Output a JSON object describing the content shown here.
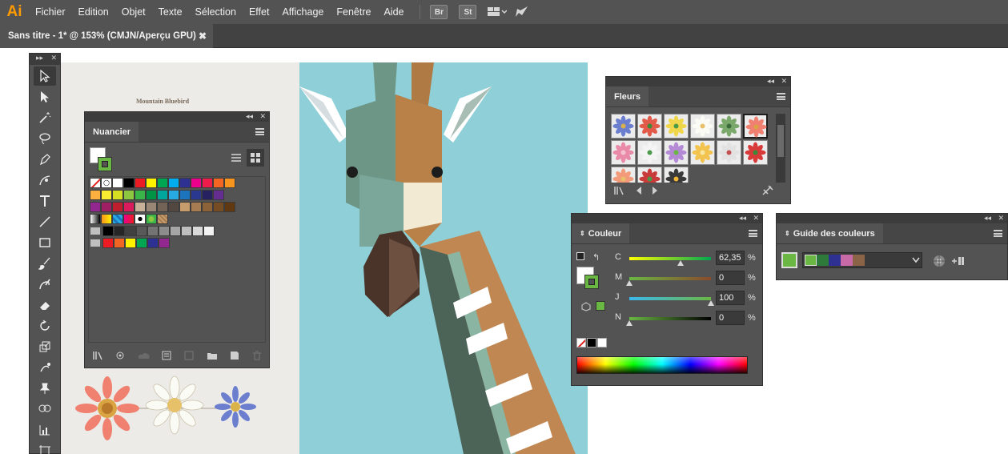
{
  "app": {
    "logo": "Ai"
  },
  "menu": [
    "Fichier",
    "Edition",
    "Objet",
    "Texte",
    "Sélection",
    "Effet",
    "Affichage",
    "Fenêtre",
    "Aide"
  ],
  "menubar_icons": {
    "bridge": "Br",
    "stock": "St",
    "workspace": "workspace-layout-icon",
    "send": "rocket-icon"
  },
  "document": {
    "tab_title": "Sans titre - 1* @ 153% (CMJN/Aperçu GPU)",
    "close": "✖"
  },
  "artboard": {
    "caption": "Mountain Bluebird"
  },
  "toolbar": {
    "tools": [
      "selection-tool",
      "direct-selection-tool",
      "magic-wand-tool",
      "lasso-tool",
      "pen-tool",
      "curvature-tool",
      "type-tool",
      "line-tool",
      "rectangle-tool",
      "paintbrush-tool",
      "shaper-tool",
      "eraser-tool",
      "rotate-tool",
      "scale-tool",
      "puppet-warp-tool",
      "pin-tool",
      "blend-tool",
      "graph-tool",
      "artboard-tool"
    ]
  },
  "swatches_panel": {
    "title": "Nuancier",
    "rows": [
      [
        "none",
        "registration",
        "#ffffff",
        "#000000",
        "#ed1c24",
        "#fff200",
        "#00a651",
        "#00aeef",
        "#2e3192",
        "#ec008c",
        "#ed1c4b",
        "#f26522",
        "#f7941d"
      ],
      [
        "#fbb040",
        "#f9ed32",
        "#d7df23",
        "#8dc63f",
        "#39b54a",
        "#009444",
        "#00a79d",
        "#27aae1",
        "#1c75bc",
        "#2b388f",
        "#262262",
        "#662d91"
      ],
      [
        "#92278f",
        "#9e1f63",
        "#be1e2d",
        "#da1c5c",
        "#c7b299",
        "#998675",
        "#736357",
        "#534741",
        "#c69c6d",
        "#a67c52",
        "#8c6239",
        "#754c24",
        "#603913"
      ],
      [
        "gradient-white-black",
        "gradient-orange-yellow",
        "gradient-blue",
        "gradient-pink",
        "pattern-dots",
        "pattern-leaf",
        "pattern-texture"
      ],
      [
        "folder",
        "#000000",
        "#262626",
        "#404040",
        "#595959",
        "#737373",
        "#8c8c8c",
        "#a6a6a6",
        "#bfbfbf",
        "#d9d9d9",
        "#f2f2f2"
      ],
      [
        "folder",
        "#ed1c24",
        "#f26522",
        "#fff200",
        "#00a651",
        "#2e3192",
        "#92278f"
      ]
    ]
  },
  "fleurs_panel": {
    "title": "Fleurs"
  },
  "couleur_panel": {
    "title": "Couleur",
    "sliders": [
      {
        "label": "C",
        "value": "62,35",
        "pct": "%",
        "pos": 62.35
      },
      {
        "label": "M",
        "value": "0",
        "pct": "%",
        "pos": 0
      },
      {
        "label": "J",
        "value": "100",
        "pct": "%",
        "pos": 100
      },
      {
        "label": "N",
        "value": "0",
        "pct": "%",
        "pos": 0
      }
    ]
  },
  "guide_panel": {
    "title": "Guide des couleurs",
    "harmony": [
      "#6ab744",
      "#2e7a3a",
      "#2e3192",
      "#c86aa8",
      "#8b6448"
    ]
  },
  "colors": {
    "fill_green": "#6ab744",
    "accent_orange": "#ff9a00"
  }
}
